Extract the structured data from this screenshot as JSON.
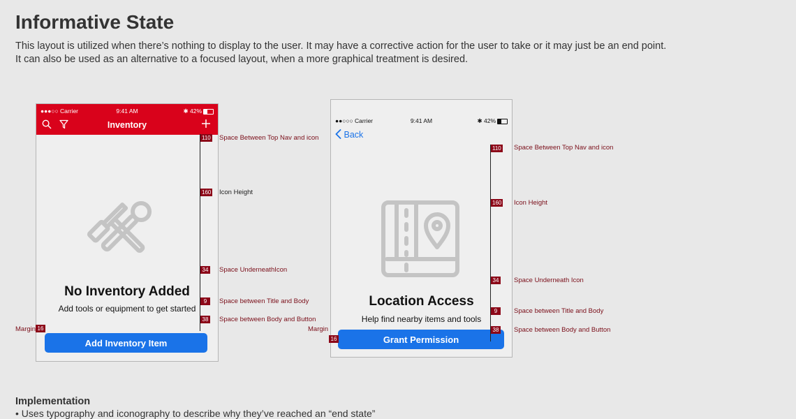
{
  "header": {
    "title": "Informative State",
    "intro_line1": "This layout is utilized when there’s nothing to display to the user. It may have a corrective action for the user to take or it may just be an end point.",
    "intro_line2": "It can also be used as an alternative to a focused layout, when a more graphical treatment is desired."
  },
  "phone1": {
    "status": {
      "carrier": "●●●○○ Carrier",
      "time": "9:41 AM",
      "battery": "42%"
    },
    "nav_title": "Inventory",
    "icons": [
      "search-icon",
      "filter-icon",
      "plus-icon",
      "tools-icon"
    ],
    "empty_title": "No Inventory Added",
    "empty_body": "Add tools or equipment to get started",
    "button_label": "Add Inventory Item",
    "margin_label": "Margin",
    "margin_value": "16",
    "specs": [
      {
        "value": "110",
        "label": "Space Between Top Nav and icon"
      },
      {
        "value": "160",
        "label": "Icon Height"
      },
      {
        "value": "34",
        "label": "Space UnderneathIcon"
      },
      {
        "value": "9",
        "label": "Space between Title and Body"
      },
      {
        "value": "38",
        "label": "Space between Body and Button"
      }
    ]
  },
  "phone2": {
    "status": {
      "carrier": "●●○○○ Carrier",
      "time": "9:41 AM",
      "battery": "42%"
    },
    "back_label": "Back",
    "icons": [
      "chevron-left-icon",
      "map-pin-icon"
    ],
    "empty_title": "Location Access",
    "empty_body": "Help find nearby items and tools",
    "button_label": "Grant Permission",
    "margin_label": "Margin",
    "margin_value": "16",
    "specs": [
      {
        "value": "110",
        "label": "Space Between Top Nav and icon"
      },
      {
        "value": "160",
        "label": "Icon Height"
      },
      {
        "value": "34",
        "label": "Space Underneath Icon"
      },
      {
        "value": "9",
        "label": "Space between Title and Body"
      },
      {
        "value": "38",
        "label": "Space between Body and Button"
      }
    ]
  },
  "implementation": {
    "title": "Implementation",
    "bullet": "• Uses typography and iconography to describe why they’ve reached an “end state”"
  },
  "colors": {
    "accent_red": "#d9021b",
    "button_blue": "#1a73e8",
    "spec_red": "#8c0718"
  }
}
